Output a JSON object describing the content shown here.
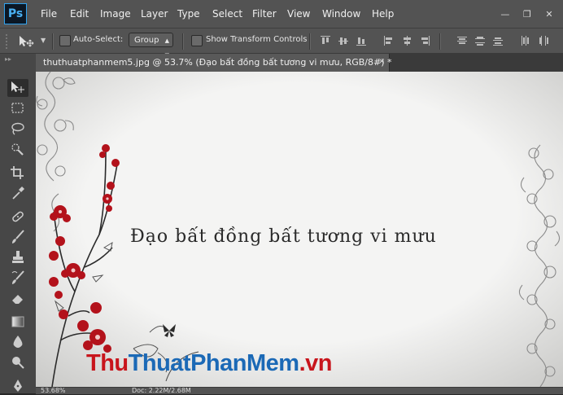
{
  "app": {
    "logo": "Ps"
  },
  "menu": [
    "File",
    "Edit",
    "Image",
    "Layer",
    "Type",
    "Select",
    "Filter",
    "View",
    "Window",
    "Help"
  ],
  "window_controls": {
    "minimize": "—",
    "maximize": "❐",
    "close": "✕"
  },
  "options": {
    "tool_icon": "move-tool-icon",
    "auto_select_label": "Auto-Select:",
    "auto_select_checked": false,
    "group_value": "Group",
    "show_transform_label": "Show Transform Controls",
    "show_transform_checked": false
  },
  "tab": {
    "title": "thuthuatphanmem5.jpg @ 53.7% (Đạo bất đồng bất tương vi mưu, RGB/8#) *",
    "close": "×"
  },
  "tools": [
    "move-tool",
    "rectangular-marquee-tool",
    "lasso-tool",
    "quick-selection-tool",
    "crop-tool",
    "eyedropper-tool",
    "spot-healing-brush-tool",
    "brush-tool",
    "clone-stamp-tool",
    "history-brush-tool",
    "eraser-tool",
    "gradient-tool",
    "blur-tool",
    "dodge-tool",
    "pen-tool"
  ],
  "canvas": {
    "text": "Đạo bất đồng bất tương vi mưu"
  },
  "watermark": {
    "part1": "Thu",
    "part2": "ThuatPhanMem",
    "part3": ".vn"
  },
  "status": {
    "zoom": "53.68%",
    "doc": "Doc: 2.22M/2.68M"
  }
}
